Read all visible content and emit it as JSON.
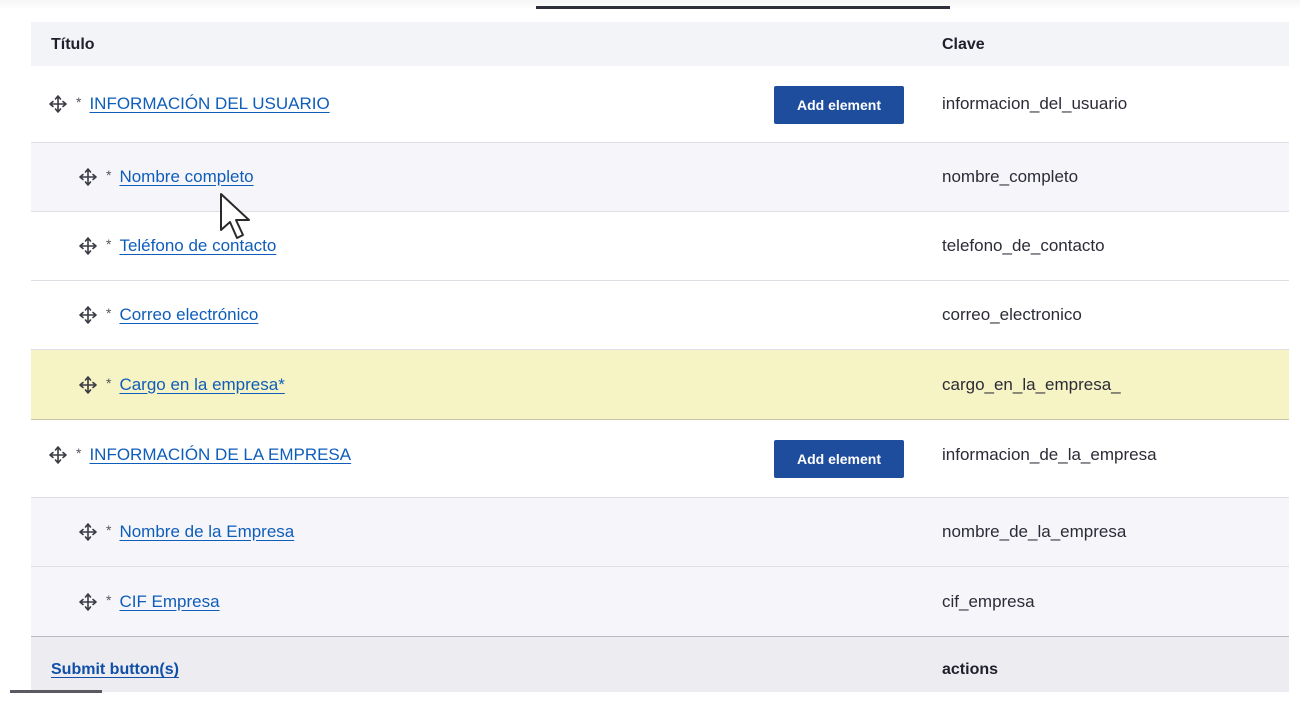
{
  "table": {
    "header": {
      "title": "Título",
      "key": "Clave"
    },
    "rows": [
      {
        "title": "INFORMACIÓN DEL USUARIO",
        "required": "*",
        "key": "informacion_del_usuario",
        "level": 0,
        "button": "Add element"
      },
      {
        "title": "Nombre completo",
        "required": "*",
        "key": "nombre_completo",
        "level": 1
      },
      {
        "title": "Teléfono de contacto",
        "required": "*",
        "key": "telefono_de_contacto",
        "level": 1
      },
      {
        "title": "Correo electrónico",
        "required": "*",
        "key": "correo_electronico",
        "level": 1
      },
      {
        "title": "Cargo en la empresa*",
        "required": "*",
        "key": "cargo_en_la_empresa_",
        "level": 1
      },
      {
        "title": "INFORMACIÓN DE LA EMPRESA",
        "required": "*",
        "key": "informacion_de_la_empresa",
        "level": 0,
        "button": "Add element"
      },
      {
        "title": "Nombre de la Empresa",
        "required": "*",
        "key": "nombre_de_la_empresa",
        "level": 1
      },
      {
        "title": "CIF Empresa",
        "required": "*",
        "key": "cif_empresa",
        "level": 1
      }
    ],
    "footer": {
      "title": "Submit button(s)",
      "key": "actions"
    }
  },
  "colors": {
    "link": "#0f5dba",
    "button": "#1f4d9e",
    "highlight_row": "#f6f3c4"
  },
  "icons": {
    "drag_handle": "move-arrows-icon",
    "pointer": "mouse-pointer-icon"
  }
}
